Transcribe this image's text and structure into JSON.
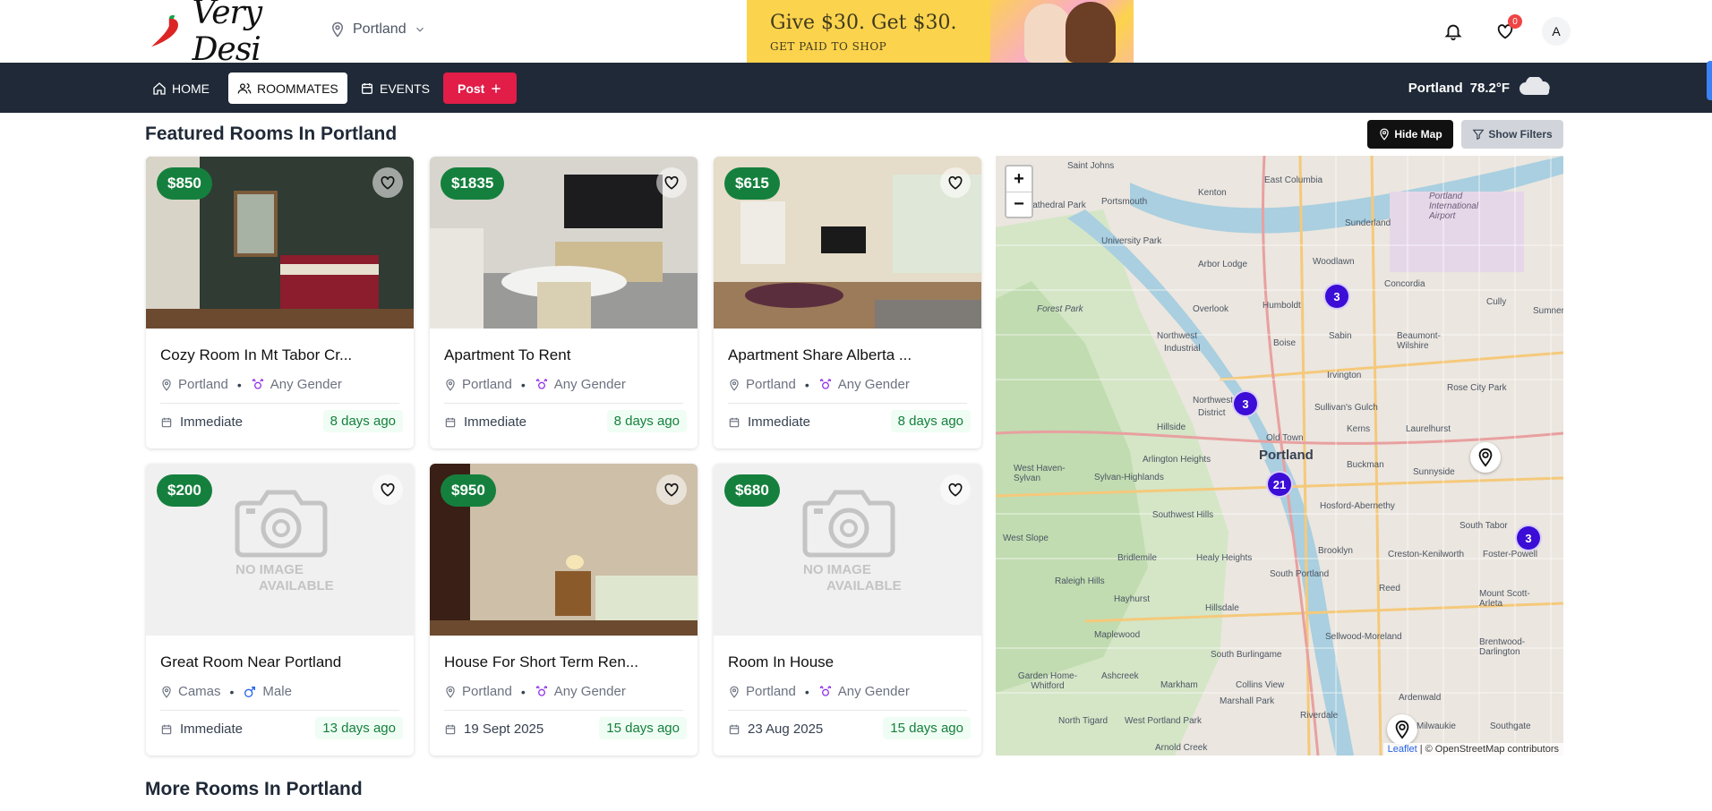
{
  "header": {
    "logo_text": "Very Desi",
    "location": "Portland",
    "banner_line1": "Give $30. Get $30.",
    "banner_line2": "GET PAID TO SHOP",
    "favorites_count": "0",
    "avatar_initial": "A"
  },
  "nav": {
    "home": "HOME",
    "roommates": "ROOMMATES",
    "events": "EVENTS",
    "post": "Post"
  },
  "weather": {
    "city": "Portland",
    "temp": "78.2°F"
  },
  "featured": {
    "title": "Featured Rooms In Portland",
    "hide_map": "Hide Map",
    "show_filters": "Show Filters",
    "listings": [
      {
        "price": "$850",
        "title": "Cozy Room In Mt Tabor Cr...",
        "location": "Portland",
        "gender": "Any Gender",
        "availability": "Immediate",
        "posted": "8 days ago"
      },
      {
        "price": "$1835",
        "title": "Apartment To Rent",
        "location": "Portland",
        "gender": "Any Gender",
        "availability": "Immediate",
        "posted": "8 days ago"
      },
      {
        "price": "$615",
        "title": "Apartment Share Alberta ...",
        "location": "Portland",
        "gender": "Any Gender",
        "availability": "Immediate",
        "posted": "8 days ago"
      },
      {
        "price": "$200",
        "title": "Great Room Near Portland",
        "location": "Camas",
        "gender": "Male",
        "availability": "Immediate",
        "posted": "13 days ago"
      },
      {
        "price": "$950",
        "title": "House For Short Term Ren...",
        "location": "Portland",
        "gender": "Any Gender",
        "availability": "19 Sept 2025",
        "posted": "15 days ago"
      },
      {
        "price": "$680",
        "title": "Room In House",
        "location": "Portland",
        "gender": "Any Gender",
        "availability": "23 Aug 2025",
        "posted": "15 days ago"
      }
    ],
    "no_image_line1": "NO IMAGE",
    "no_image_line2": "AVAILABLE"
  },
  "map": {
    "zoom_in": "+",
    "zoom_out": "−",
    "clusters": [
      "3",
      "3",
      "21",
      "3"
    ],
    "attribution_leaflet": "Leaflet",
    "attribution_rest": "| © OpenStreetMap contributors",
    "labels": {
      "portland": "Portland",
      "saint_johns": "Saint Johns",
      "portsmouth": "Portsmouth",
      "east_columbia": "East Columbia",
      "university_park": "University Park",
      "kenton": "Kenton",
      "sunderland": "Sunderland",
      "arbor_lodge": "Arbor Lodge",
      "woodlawn": "Woodlawn",
      "concordia": "Concordia",
      "forest_park": "Forest Park",
      "overlook": "Overlook",
      "humboldt": "Humboldt",
      "sabin": "Sabin",
      "beaumont_wilshire": "Beaumont-Wilshire",
      "northwest_industrial": "Northwest Industrial",
      "boise": "Boise",
      "irvington": "Irvington",
      "rose_city_park": "Rose City Park",
      "northwest_district": "Northwest District",
      "sullivans_gulch": "Sullivan's Gulch",
      "old_town": "Old Town",
      "kerns": "Kerns",
      "laurelhurst": "Laurelhurst",
      "hillside": "Hillside",
      "arlington_heights": "Arlington Heights",
      "buckman": "Buckman",
      "sunnyside": "Sunnyside",
      "west_haven_sylvan": "West Haven-Sylvan",
      "sylvan_highlands": "Sylvan-Highlands",
      "hosford_abernethy": "Hosford-Abernethy",
      "southwest_hills": "Southwest Hills",
      "south_tabor": "South Tabor",
      "west_slope": "West Slope",
      "bridlemile": "Bridlemile",
      "healy_heights": "Healy Heights",
      "south_portland": "South Portland",
      "brooklyn": "Brooklyn",
      "creston_kenilworth": "Creston-Kenilworth",
      "foster_powell": "Foster-Powell",
      "raleigh_hills": "Raleigh Hills",
      "hayhurst": "Hayhurst",
      "hillsdale": "Hillsdale",
      "reed": "Reed",
      "mount_scott_arleta": "Mount Scott-Arleta",
      "maplewood": "Maplewood",
      "sellwood_moreland": "Sellwood-Moreland",
      "brentwood_darlington": "Brentwood-Darlington",
      "south_burlingame": "South Burlingame",
      "garden_home_whitford": "Garden Home-Whitford",
      "ashcreek": "Ashcreek",
      "markham": "Markham",
      "collins_view": "Collins View",
      "marshall_park": "Marshall Park",
      "ardenwald": "Ardenwald",
      "riverdale": "Riverdale",
      "north_tigard": "North Tigard",
      "west_portland_park": "West Portland Park",
      "arnold_creek": "Arnold Creek",
      "milwaukie": "Milwaukie",
      "southgate": "Southgate",
      "portland_airport": "Portland International Airport",
      "cully": "Cully",
      "sumner": "Sumner"
    }
  },
  "more": {
    "title": "More Rooms In Portland"
  },
  "colors": {
    "nav_bg": "#1f2937",
    "price_badge": "#15803d",
    "post_button": "#e11d48",
    "map_cluster": "#3b0dd6"
  }
}
